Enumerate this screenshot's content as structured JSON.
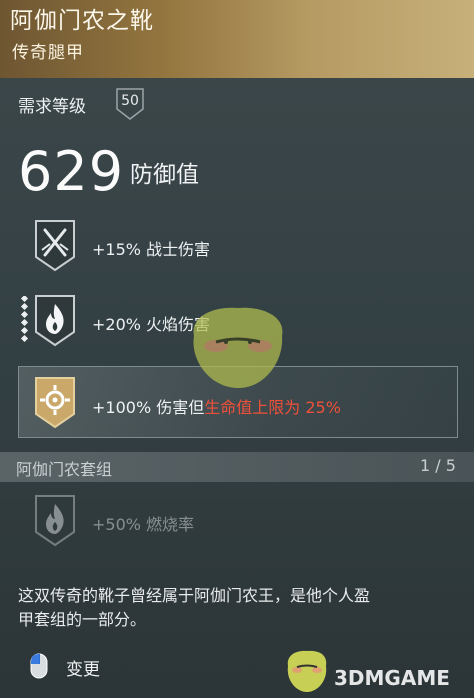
{
  "item": {
    "name": "阿伽门农之靴",
    "type": "传奇腿甲"
  },
  "requirement": {
    "label": "需求等级",
    "level": "50"
  },
  "armor": {
    "value": "629",
    "label": "防御值"
  },
  "perks": [
    {
      "icon": "crossed-swords-icon",
      "text": "+15% 战士伤害"
    },
    {
      "icon": "flame-icon",
      "text": "+20% 火焰伤害"
    },
    {
      "icon": "crosshair-icon",
      "text_normal": "+100% 伤害但",
      "text_red": "生命值上限为 25%"
    }
  ],
  "set": {
    "name": "阿伽门农套组",
    "count": "1 / 5",
    "perk": {
      "icon": "flame-icon",
      "text": "+50% 燃烧率"
    }
  },
  "description_line1": "这双传奇的靴子曾经属于阿伽门农王，是他个人盈",
  "description_line2": "甲套组的一部分。",
  "footer": {
    "change_label": "变更",
    "mouse_icon": "mouse-icon"
  },
  "watermark": "3DMGAME",
  "colors": {
    "header_gold": "#b59a62",
    "panel": "#334043",
    "warning_red": "#f0503a",
    "gold_icon": "#c9a86a"
  }
}
